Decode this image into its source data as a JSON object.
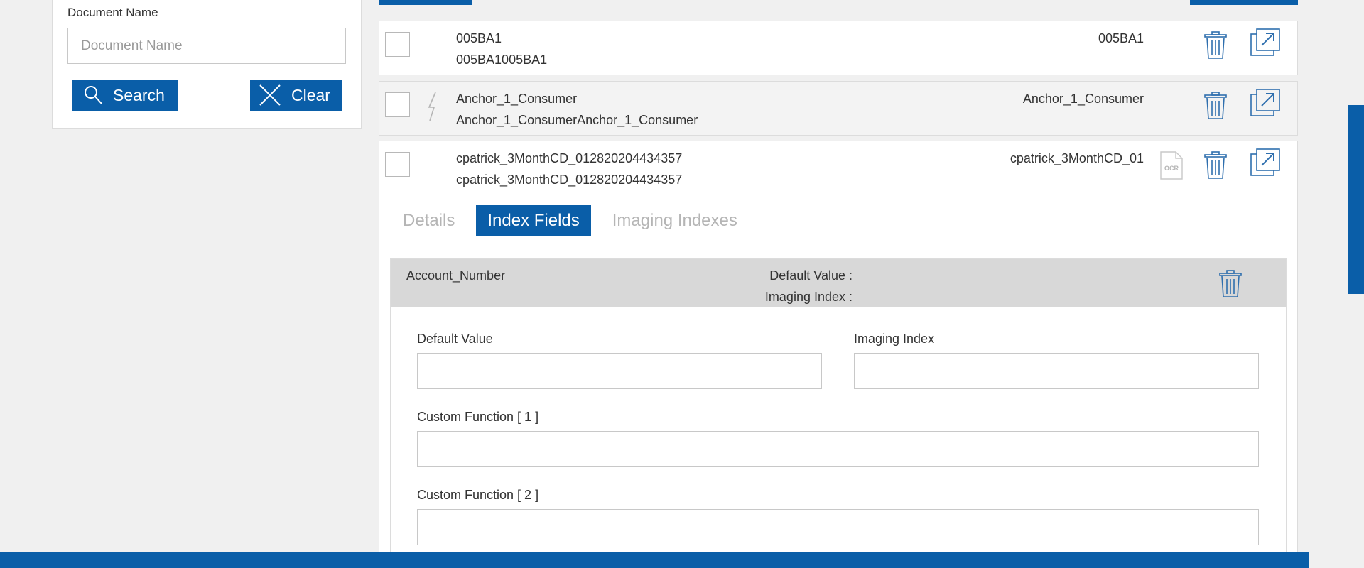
{
  "search_panel": {
    "document_name_label": "Document Name",
    "document_name_placeholder": "Document Name",
    "document_name_value": "",
    "search_label": "Search",
    "clear_label": "Clear"
  },
  "documents": [
    {
      "name": "005BA1",
      "description": "005BA1005BA1",
      "right_name": "005BA1",
      "has_bolt": false,
      "has_ocr": false
    },
    {
      "name": "Anchor_1_Consumer",
      "description": "Anchor_1_ConsumerAnchor_1_Consumer",
      "right_name": "Anchor_1_Consumer",
      "has_bolt": true,
      "has_ocr": false
    },
    {
      "name": "cpatrick_3MonthCD_012820204434357",
      "description": "cpatrick_3MonthCD_012820204434357",
      "right_name": "cpatrick_3MonthCD_01",
      "has_bolt": false,
      "has_ocr": true
    }
  ],
  "expanded": {
    "tabs": [
      {
        "label": "Details",
        "active": false
      },
      {
        "label": "Index Fields",
        "active": true
      },
      {
        "label": "Imaging Indexes",
        "active": false
      }
    ],
    "field": {
      "name": "Account_Number",
      "default_value_label": "Default Value :",
      "imaging_index_label": "Imaging Index :",
      "form": {
        "default_value_label": "Default Value",
        "default_value": "",
        "imaging_index_label": "Imaging Index",
        "imaging_index": "",
        "custom_function_1_label": "Custom Function [ 1 ]",
        "custom_function_1": "",
        "custom_function_2_label": "Custom Function [ 2 ]",
        "custom_function_2": ""
      }
    }
  },
  "icons": {
    "search": "search-icon",
    "clear": "close-icon",
    "bolt": "lightning-icon",
    "ocr": "ocr-file-icon",
    "trash": "trash-icon",
    "open": "open-external-icon"
  },
  "colors": {
    "primary": "#0a5ea8",
    "icon": "#2f6fae",
    "background": "#f0f0f0",
    "header_row": "#d8d8d8",
    "inactive_tab": "#b5b5b5"
  }
}
